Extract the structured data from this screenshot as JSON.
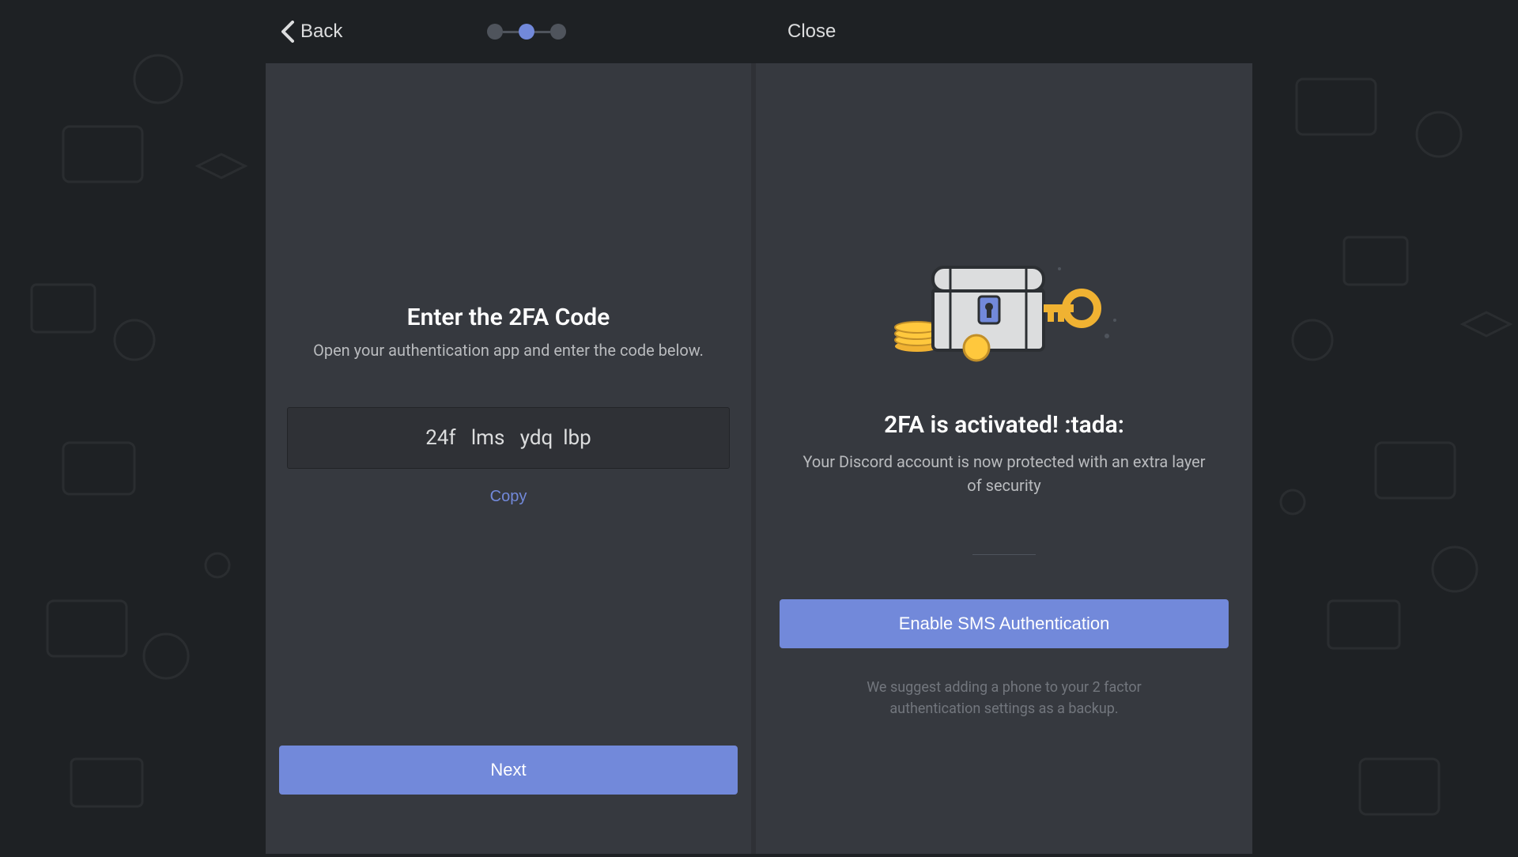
{
  "header": {
    "back_label": "Back",
    "close_label": "Close"
  },
  "left": {
    "title": "Enter the 2FA Code",
    "subtitle": "Open your authentication app and enter the code below.",
    "code_value": "24f   lms   ydq  lbp",
    "copy_label": "Copy",
    "next_label": "Next"
  },
  "right": {
    "title": "2FA is activated! :tada:",
    "subtitle": "Your Discord account is now protected with an extra layer of security",
    "sms_button_label": "Enable SMS Authentication",
    "sms_hint": "We suggest adding a phone to your 2 factor authentication settings as a backup."
  }
}
